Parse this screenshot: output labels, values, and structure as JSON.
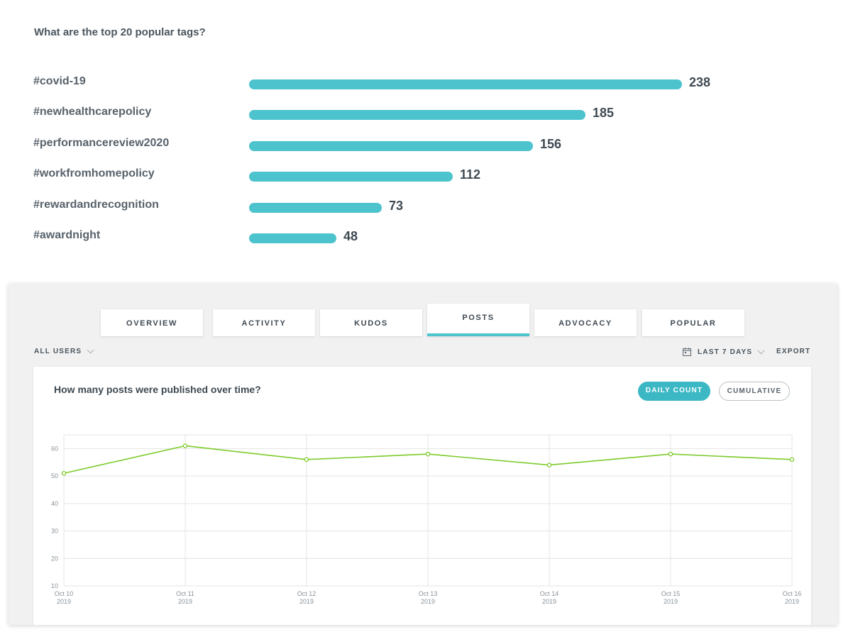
{
  "tags_section": {
    "title": "What are the top 20 popular tags?",
    "bar_color": "#4dc3cd",
    "max_value": 238,
    "tags": [
      {
        "label": "#covid-19",
        "value": 238
      },
      {
        "label": "#newhealthcarepolicy",
        "value": 185
      },
      {
        "label": "#performancereview2020",
        "value": 156
      },
      {
        "label": "#workfromhomepolicy",
        "value": 112
      },
      {
        "label": "#rewardandrecognition",
        "value": 73
      },
      {
        "label": "#awardnight",
        "value": 48
      }
    ]
  },
  "tabs": [
    {
      "label": "OVERVIEW",
      "active": false
    },
    {
      "label": "ACTIVITY",
      "active": false
    },
    {
      "label": "KUDOS",
      "active": false
    },
    {
      "label": "POSTS",
      "active": true
    },
    {
      "label": "ADVOCACY",
      "active": false
    },
    {
      "label": "POPULAR",
      "active": false
    }
  ],
  "filters": {
    "users": "ALL USERS",
    "users_icon": "chevron-down-icon",
    "date_icon": "calendar-icon",
    "date_range": "LAST 7 DAYS",
    "export": "EXPORT"
  },
  "posts_card": {
    "title": "How many posts were published over time?",
    "toggle_on": "DAILY COUNT",
    "toggle_off": "CUMULATIVE",
    "accent_color": "#3bb8c4"
  },
  "chart_data": {
    "type": "line",
    "title": "How many posts were published over time?",
    "categories": [
      "Oct 10",
      "Oct 11",
      "Oct 12",
      "Oct 13",
      "Oct 14",
      "Oct 15",
      "Oct 16"
    ],
    "category_sub": "2019",
    "series": [
      {
        "values": [
          51,
          61,
          56,
          58,
          54,
          58,
          56
        ],
        "color": "#7ccb2a"
      }
    ],
    "yticks": [
      10,
      20,
      30,
      40,
      50,
      60
    ],
    "ylim": [
      10,
      65
    ],
    "grid": true
  }
}
